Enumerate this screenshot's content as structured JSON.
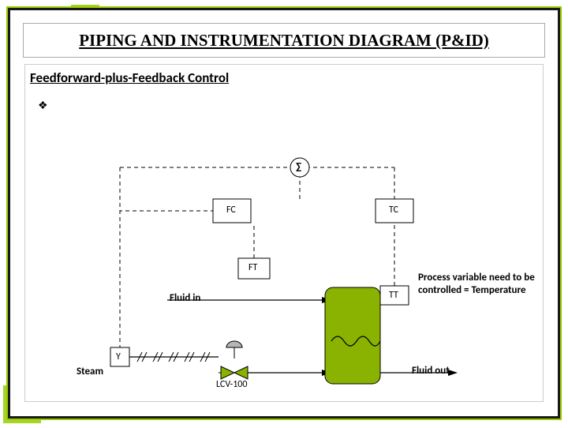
{
  "title": "PIPING AND INSTRUMENTATION DIAGRAM (P&ID)",
  "subtitle": "Feedforward-plus-Feedback Control",
  "bullet_glyph": "❖",
  "sigma": "∑",
  "blocks": {
    "fc": "FC",
    "tc": "TC",
    "ft": "FT",
    "tt": "TT",
    "y": "Y"
  },
  "labels": {
    "fluid_in": "Fluid in",
    "fluid_out": "Fluid out",
    "steam": "Steam",
    "valve_tag": "LCV-100",
    "note": "Process variable need to be controlled = Temperature"
  },
  "colors": {
    "accent": "#99cc00",
    "tank_fill": "#89b300",
    "frame": "#1a1a1a"
  }
}
